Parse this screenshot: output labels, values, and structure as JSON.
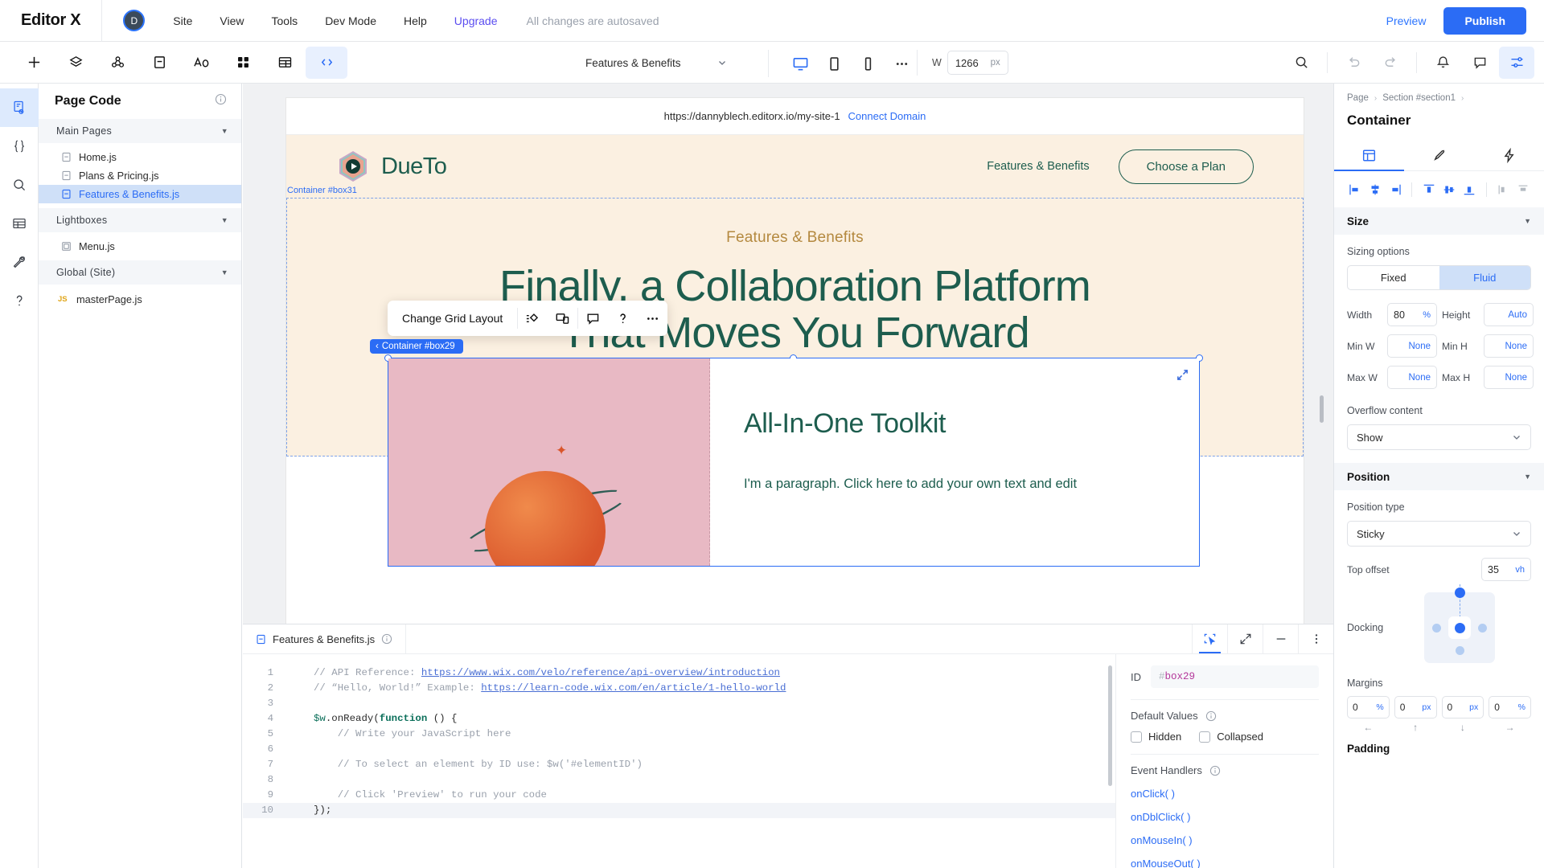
{
  "topbar": {
    "brand": "Editor X",
    "avatar_initial": "D",
    "menus": [
      "Site",
      "View",
      "Tools",
      "Dev Mode",
      "Help"
    ],
    "upgrade": "Upgrade",
    "autosave": "All changes are autosaved",
    "preview": "Preview",
    "publish": "Publish",
    "accent": "#5b4df0",
    "publish_bg": "#2b6cf5"
  },
  "toolbar": {
    "icons": [
      "add-icon",
      "layers-icon",
      "assets-icon",
      "page-icon",
      "text-icon",
      "apps-icon",
      "cms-icon",
      "dev-mode-icon"
    ],
    "page_selector": "Features & Benefits",
    "devices": [
      "desktop-icon",
      "tablet-icon",
      "mobile-icon"
    ],
    "more": "…",
    "width_label": "W",
    "width_value": "1266",
    "width_unit": "px",
    "right_icons": [
      "zoom-icon",
      "undo-icon",
      "redo-icon",
      "notifications-icon",
      "comments-icon",
      "settings-icon"
    ]
  },
  "rail": {
    "items": [
      "page-code-icon",
      "code-braces-icon",
      "search-icon",
      "database-icon",
      "tools-wrench-icon",
      "help-icon"
    ]
  },
  "panel": {
    "title": "Page Code",
    "groups": [
      {
        "name": "Main Pages",
        "files": [
          {
            "label": "Home.js",
            "icon": "page-file-icon",
            "selected": false
          },
          {
            "label": "Plans & Pricing.js",
            "icon": "page-file-icon",
            "selected": false
          },
          {
            "label": "Features & Benefits.js",
            "icon": "page-file-icon",
            "selected": true
          }
        ]
      },
      {
        "name": "Lightboxes",
        "files": [
          {
            "label": "Menu.js",
            "icon": "lightbox-file-icon",
            "selected": false
          }
        ]
      },
      {
        "name": "Global (Site)",
        "files": [
          {
            "label": "masterPage.js",
            "icon": "js-badge-icon",
            "selected": false
          }
        ]
      }
    ]
  },
  "canvas": {
    "url": "https://dannyblech.editorx.io/my-site-1",
    "connect_domain": "Connect Domain",
    "site": {
      "brand": "DueTo",
      "nav_link": "Features & Benefits",
      "cta": "Choose a Plan",
      "hero_eyebrow": "Features & Benefits",
      "hero_line1": "Finally, a Collaboration Platform",
      "hero_line2": "That Moves You Forward",
      "card_heading": "All-In-One Toolkit",
      "card_paragraph": "I'm a paragraph. Click here to add your own text and edit",
      "brand_color": "#1d5d4e",
      "eyebrow_color": "#b4893f",
      "bg_color": "#fbf0e1"
    },
    "tag_box31": "Container #box31",
    "tag_box29": "Container #box29",
    "floatbar": {
      "label": "Change Grid Layout",
      "icons": [
        "grid-layout-icon",
        "responsive-icon",
        "comment-icon",
        "help-icon",
        "more-icon"
      ]
    }
  },
  "code": {
    "tab_label": "Features & Benefits.js",
    "tools": [
      "select-element-icon",
      "expand-icon",
      "minimize-icon",
      "more-vert-icon"
    ],
    "lines": [
      {
        "n": "1",
        "segs": [
          {
            "t": "// API Reference: ",
            "c": "cmt"
          },
          {
            "t": "https://www.wix.com/velo/reference/api-overview/introduction",
            "c": "lnk"
          }
        ]
      },
      {
        "n": "2",
        "segs": [
          {
            "t": "// “Hello, World!” Example: ",
            "c": "cmt"
          },
          {
            "t": "https://learn-code.wix.com/en/article/1-hello-world",
            "c": "lnk"
          }
        ]
      },
      {
        "n": "3",
        "segs": []
      },
      {
        "n": "4",
        "segs": [
          {
            "t": "$w",
            "c": "vr"
          },
          {
            "t": ".onReady(",
            "c": ""
          },
          {
            "t": "function",
            "c": "kw"
          },
          {
            "t": " () {",
            "c": ""
          }
        ]
      },
      {
        "n": "5",
        "segs": [
          {
            "t": "    // Write your JavaScript here",
            "c": "cmt"
          }
        ]
      },
      {
        "n": "6",
        "segs": []
      },
      {
        "n": "7",
        "segs": [
          {
            "t": "    // To select an element by ID use: $w('#elementID')",
            "c": "cmt"
          }
        ]
      },
      {
        "n": "8",
        "segs": []
      },
      {
        "n": "9",
        "segs": [
          {
            "t": "    // Click 'Preview' to run your code",
            "c": "cmt"
          }
        ]
      },
      {
        "n": "10",
        "segs": [
          {
            "t": "});",
            "c": ""
          }
        ],
        "hl": true
      }
    ],
    "props": {
      "id_label": "ID",
      "id_hash": "#",
      "id_value": "box29",
      "default_values_label": "Default Values",
      "hidden_label": "Hidden",
      "collapsed_label": "Collapsed",
      "event_handlers_label": "Event Handlers",
      "events": [
        "onClick( )",
        "onDblClick( )",
        "onMouseIn( )",
        "onMouseOut( )"
      ]
    }
  },
  "inspector": {
    "breadcrumbs": [
      "Page",
      "Section #section1"
    ],
    "title": "Container",
    "tabs": [
      "layout-tab-icon",
      "design-tab-icon",
      "interactions-tab-icon"
    ],
    "align_icons": [
      "align-left-icon",
      "align-center-h-icon",
      "align-right-icon",
      "align-top-icon",
      "align-middle-v-icon",
      "align-bottom-icon",
      "distribute-h-icon",
      "distribute-v-icon"
    ],
    "size": {
      "header": "Size",
      "sizing_options_label": "Sizing options",
      "seg_fixed": "Fixed",
      "seg_fluid": "Fluid",
      "seg_selected": "Fluid",
      "width_label": "Width",
      "width_value": "80",
      "width_unit": "%",
      "height_label": "Height",
      "height_value": "Auto",
      "minw_label": "Min W",
      "minw_value": "None",
      "minh_label": "Min H",
      "minh_value": "None",
      "maxw_label": "Max W",
      "maxw_value": "None",
      "maxh_label": "Max H",
      "maxh_value": "None",
      "overflow_label": "Overflow content",
      "overflow_value": "Show"
    },
    "position": {
      "header": "Position",
      "type_label": "Position type",
      "type_value": "Sticky",
      "topoffset_label": "Top offset",
      "topoffset_value": "35",
      "topoffset_unit": "vh",
      "docking_label": "Docking",
      "margins_label": "Margins",
      "margins": [
        {
          "value": "0",
          "unit": "%"
        },
        {
          "value": "0",
          "unit": "px"
        },
        {
          "value": "0",
          "unit": "px"
        },
        {
          "value": "0",
          "unit": "%"
        }
      ],
      "margin_arrows": [
        "←",
        "↑",
        "↓",
        "→"
      ],
      "padding_label": "Padding"
    }
  }
}
